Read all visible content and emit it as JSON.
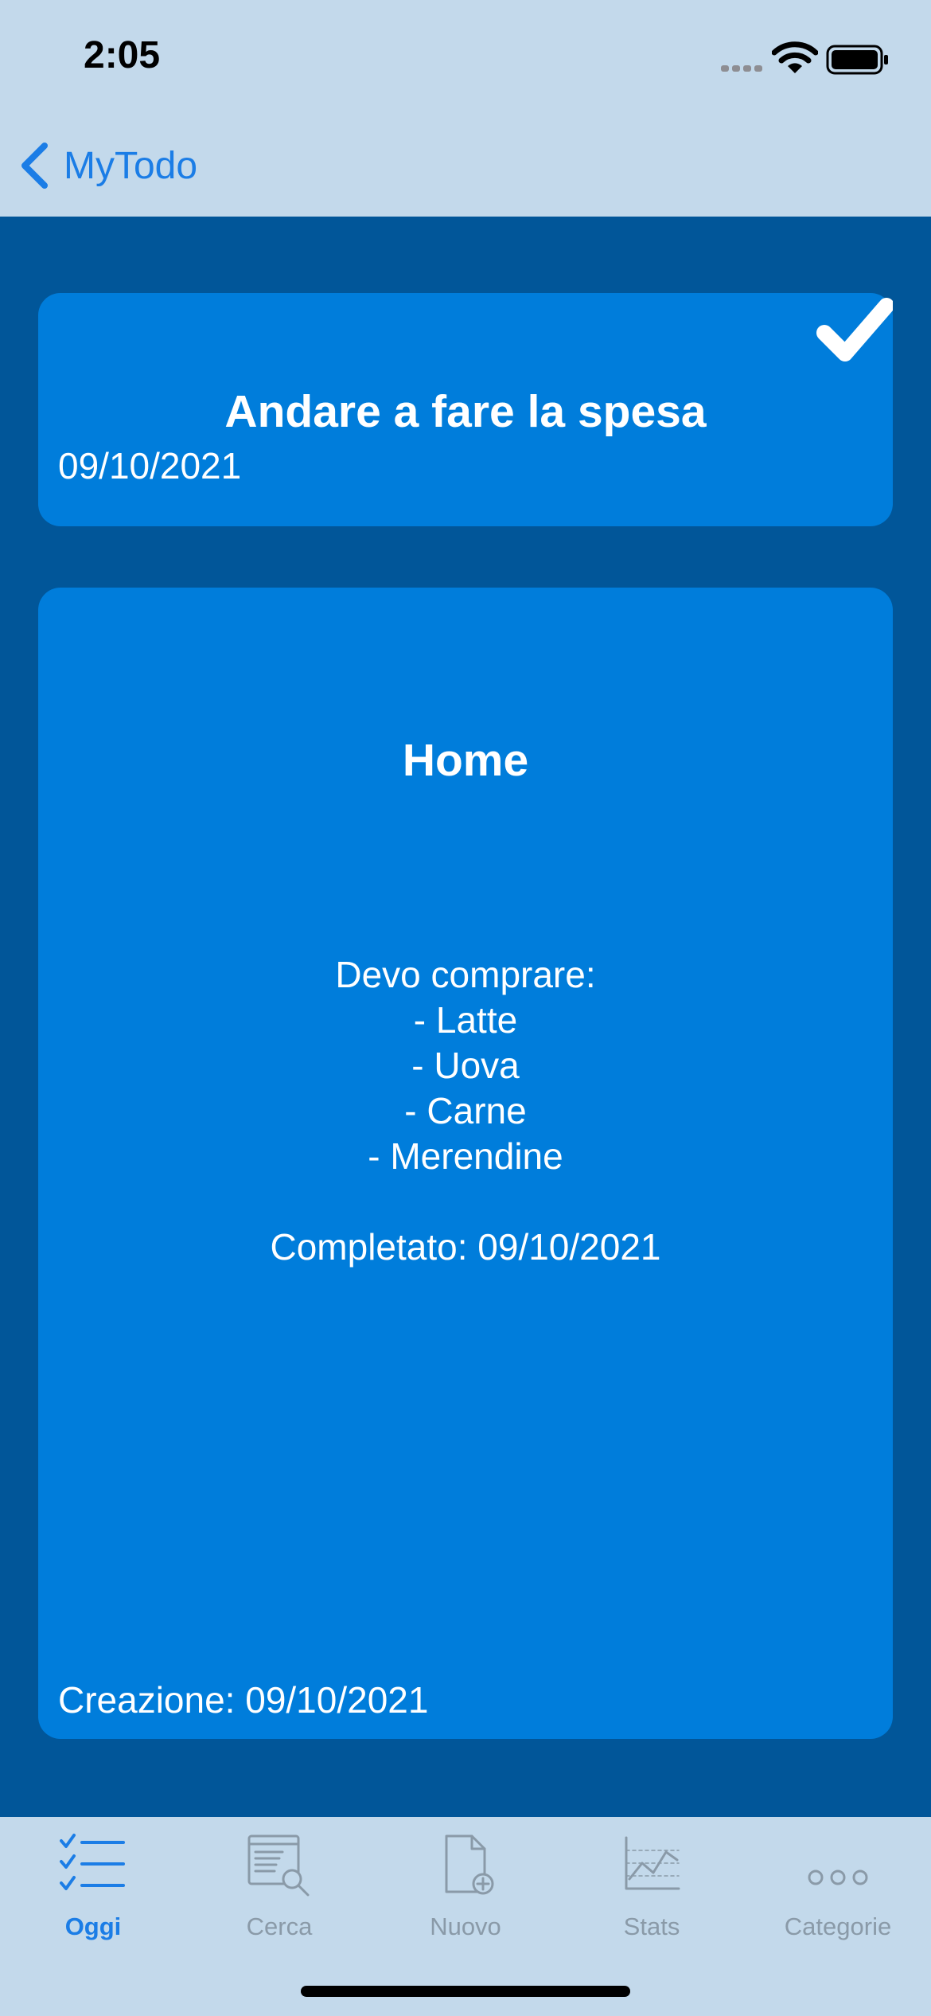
{
  "status_bar": {
    "time": "2:05"
  },
  "nav": {
    "back_label": "MyTodo"
  },
  "todo": {
    "title": "Andare a fare la spesa",
    "date": "09/10/2021",
    "completed": true,
    "category": "Home",
    "notes": [
      "Devo comprare:",
      "- Latte",
      "- Uova",
      "- Carne",
      "- Merendine",
      "",
      "Completato: 09/10/2021"
    ],
    "creation": "Creazione: 09/10/2021"
  },
  "tabs": [
    {
      "label": "Oggi",
      "icon": "checklist-icon",
      "active": true
    },
    {
      "label": "Cerca",
      "icon": "search-document-icon",
      "active": false
    },
    {
      "label": "Nuovo",
      "icon": "new-document-icon",
      "active": false
    },
    {
      "label": "Stats",
      "icon": "chart-icon",
      "active": false
    },
    {
      "label": "Categorie",
      "icon": "more-icon",
      "active": false
    }
  ],
  "colors": {
    "accent": "#1b7de6",
    "background": "#015699",
    "card": "#007ddb",
    "bars": "#c3d9eb",
    "inactive": "#8a9aa8"
  }
}
